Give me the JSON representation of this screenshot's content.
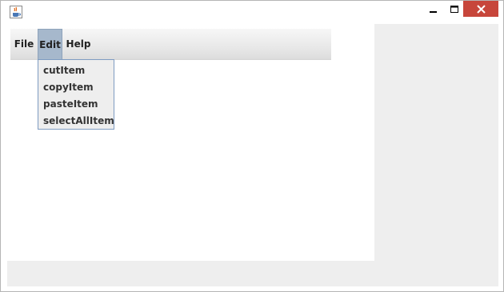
{
  "titlebar": {
    "app_icon": "java-coffee-cup-icon",
    "controls": {
      "minimize_icon": "minimize-icon",
      "maximize_icon": "maximize-icon",
      "close_icon": "close-icon",
      "close_color": "#c7463b"
    }
  },
  "menubar": {
    "menus": [
      {
        "label": "File"
      },
      {
        "label": "Edit",
        "active": true
      },
      {
        "label": "Help"
      }
    ]
  },
  "edit_menu": {
    "items": [
      {
        "label": "cutItem"
      },
      {
        "label": "copyItem"
      },
      {
        "label": "pasteItem"
      },
      {
        "label": "selectAllItem"
      }
    ]
  },
  "colors": {
    "active_menu_bg": "#a6b8cc",
    "dropdown_border": "#7f9cc2",
    "client_bg": "#eeeeee"
  }
}
